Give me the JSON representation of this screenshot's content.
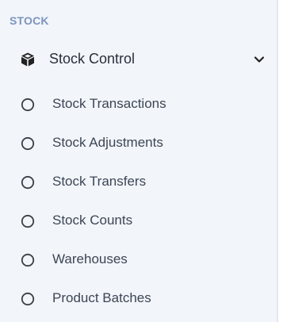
{
  "section": {
    "header": "STOCK"
  },
  "group": {
    "icon": "cube-icon",
    "label": "Stock Control",
    "expander_icon": "chevron-down-icon",
    "expanded": true
  },
  "submenu": {
    "item_icon": "circle-outline-icon",
    "items": [
      {
        "label": "Stock Transactions"
      },
      {
        "label": "Stock Adjustments"
      },
      {
        "label": "Stock Transfers"
      },
      {
        "label": "Stock Counts"
      },
      {
        "label": "Warehouses"
      },
      {
        "label": "Product Batches"
      }
    ]
  },
  "colors": {
    "panel_background": "#f2f5fa",
    "section_header": "#7c95bd",
    "group_text": "#2a2f3a",
    "item_text": "#3d4654",
    "icon": "#222222"
  }
}
